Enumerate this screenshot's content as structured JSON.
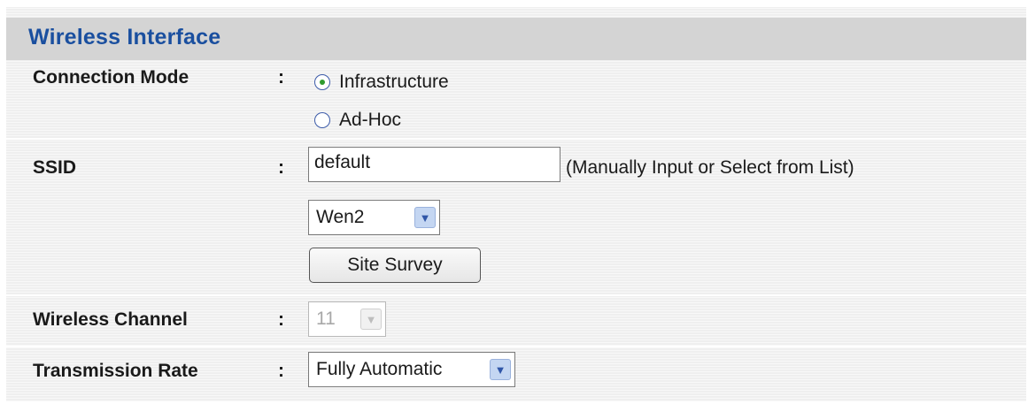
{
  "section": {
    "title": "Wireless Interface"
  },
  "connection_mode": {
    "label": "Connection Mode",
    "separator": ":",
    "options": [
      {
        "label": "Infrastructure",
        "selected": true
      },
      {
        "label": "Ad-Hoc",
        "selected": false
      }
    ]
  },
  "ssid": {
    "label": "SSID",
    "separator": ":",
    "value": "default",
    "hint": "(Manually Input or Select from List)",
    "list_selected": "Wen2",
    "site_survey_label": "Site Survey"
  },
  "wireless_channel": {
    "label": "Wireless Channel",
    "separator": ":",
    "selected": "11",
    "disabled": true
  },
  "transmission_rate": {
    "label": "Transmission Rate",
    "separator": ":",
    "selected": "Fully Automatic"
  },
  "icons": {
    "dropdown_arrow": "chevron-down-icon",
    "radio_selected_color": "#2f9b2f"
  },
  "colors": {
    "title": "#1a4f9f",
    "header_bar": "#d4d4d4",
    "panel": "#efefef",
    "dropdown_accent": "#c4d6f2"
  }
}
